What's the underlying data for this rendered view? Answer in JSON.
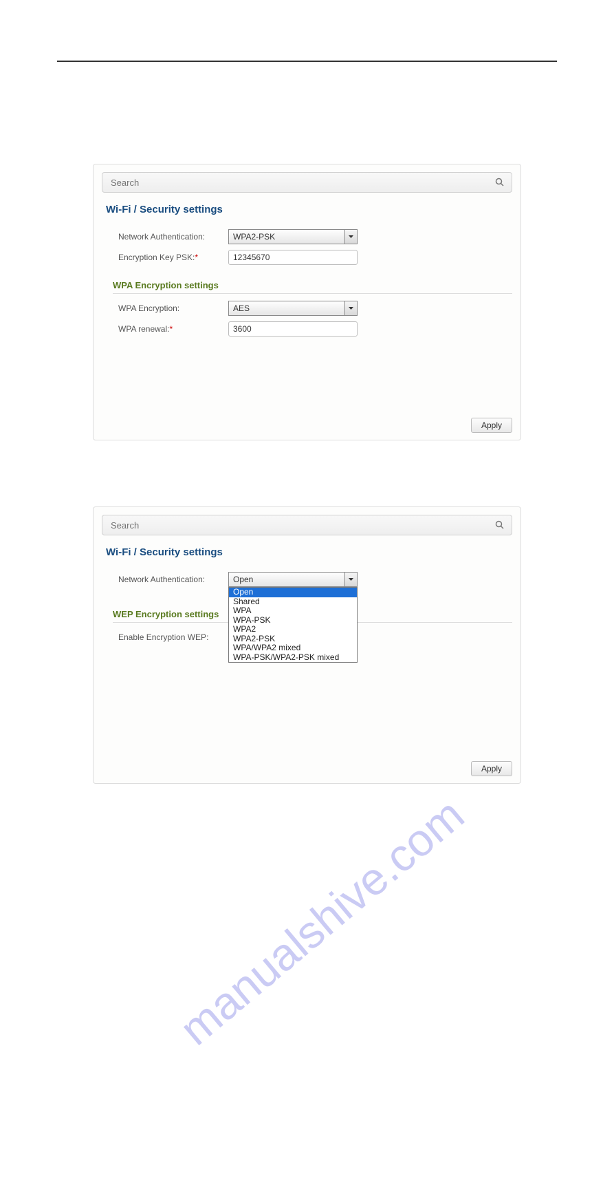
{
  "search": {
    "placeholder": "Search"
  },
  "breadcrumb": "Wi-Fi /  Security settings",
  "panel1": {
    "net_auth_label": "Network Authentication:",
    "net_auth_value": "WPA2-PSK",
    "enc_key_label": "Encryption Key PSK:",
    "enc_key_value": "12345670",
    "section_head": "WPA Encryption settings",
    "wpa_enc_label": "WPA Encryption:",
    "wpa_enc_value": "AES",
    "wpa_renew_label": "WPA renewal:",
    "wpa_renew_value": "3600"
  },
  "panel2": {
    "net_auth_label": "Network Authentication:",
    "net_auth_value": "Open",
    "section_head": "WEP Encryption settings",
    "enable_wep_label": "Enable Encryption WEP:",
    "options": [
      "Open",
      "Shared",
      "WPA",
      "WPA-PSK",
      "WPA2",
      "WPA2-PSK",
      "WPA/WPA2 mixed",
      "WPA-PSK/WPA2-PSK mixed"
    ]
  },
  "apply_label": "Apply",
  "watermark_text": "manualshive.com"
}
